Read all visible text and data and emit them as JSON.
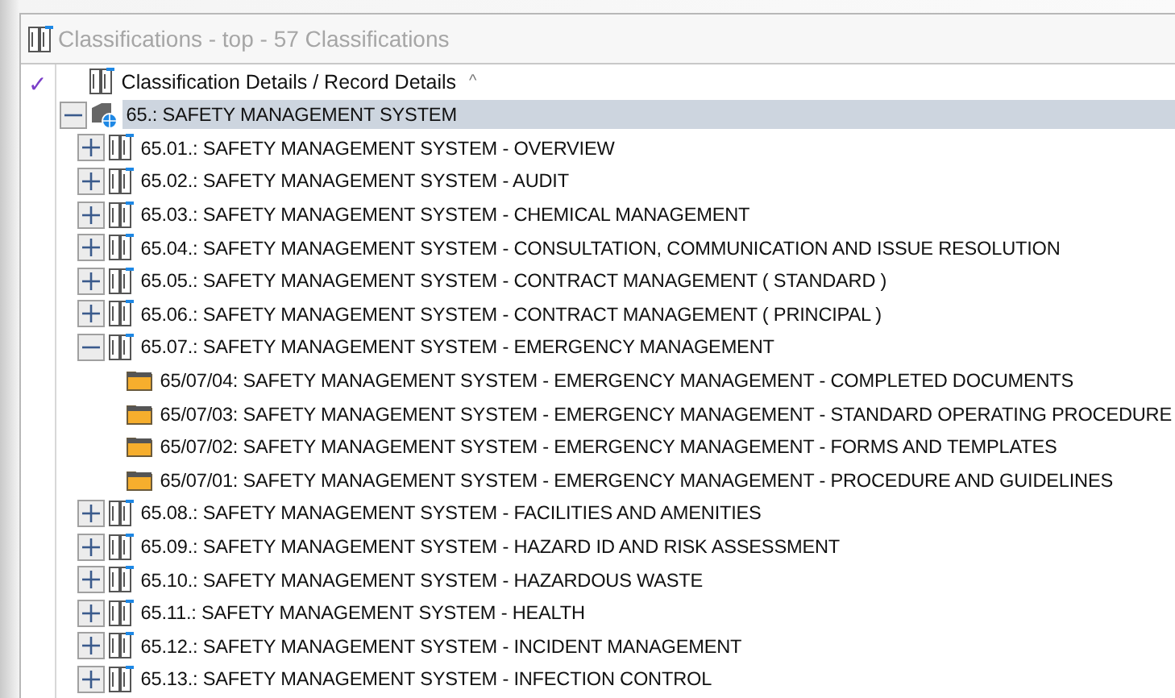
{
  "window": {
    "title": "Classifications - top - 57 Classifications"
  },
  "header": {
    "checked": true,
    "check_mark": "✓",
    "column": "Classification Details / Record Details",
    "sort": "^"
  },
  "tree": [
    {
      "label": "65.: SAFETY MANAGEMENT SYSTEM",
      "kind": "root",
      "expanded": true,
      "selected": true,
      "children": [
        {
          "label": "65.01.: SAFETY MANAGEMENT SYSTEM - OVERVIEW",
          "kind": "classification",
          "expanded": false,
          "selected": false
        },
        {
          "label": "65.02.: SAFETY MANAGEMENT SYSTEM - AUDIT",
          "kind": "classification",
          "expanded": false,
          "selected": false
        },
        {
          "label": "65.03.: SAFETY MANAGEMENT SYSTEM - CHEMICAL MANAGEMENT",
          "kind": "classification",
          "expanded": false,
          "selected": false
        },
        {
          "label": "65.04.: SAFETY MANAGEMENT SYSTEM - CONSULTATION, COMMUNICATION AND ISSUE RESOLUTION",
          "kind": "classification",
          "expanded": false,
          "selected": false
        },
        {
          "label": "65.05.: SAFETY MANAGEMENT SYSTEM - CONTRACT MANAGEMENT ( STANDARD )",
          "kind": "classification",
          "expanded": false,
          "selected": false
        },
        {
          "label": "65.06.: SAFETY MANAGEMENT SYSTEM - CONTRACT MANAGEMENT ( PRINCIPAL )",
          "kind": "classification",
          "expanded": false,
          "selected": false
        },
        {
          "label": "65.07.: SAFETY MANAGEMENT SYSTEM - EMERGENCY MANAGEMENT",
          "kind": "classification",
          "expanded": true,
          "selected": false,
          "children": [
            {
              "label": "65/07/04: SAFETY MANAGEMENT SYSTEM - EMERGENCY MANAGEMENT - COMPLETED DOCUMENTS",
              "kind": "folder",
              "selected": false
            },
            {
              "label": "65/07/03: SAFETY MANAGEMENT SYSTEM - EMERGENCY MANAGEMENT - STANDARD OPERATING PROCEDURE",
              "kind": "folder",
              "selected": false
            },
            {
              "label": "65/07/02: SAFETY MANAGEMENT SYSTEM - EMERGENCY MANAGEMENT - FORMS AND TEMPLATES",
              "kind": "folder",
              "selected": false
            },
            {
              "label": "65/07/01: SAFETY MANAGEMENT SYSTEM - EMERGENCY MANAGEMENT - PROCEDURE AND GUIDELINES",
              "kind": "folder",
              "selected": false
            }
          ]
        },
        {
          "label": "65.08.: SAFETY MANAGEMENT SYSTEM - FACILITIES AND AMENITIES",
          "kind": "classification",
          "expanded": false,
          "selected": false
        },
        {
          "label": "65.09.: SAFETY MANAGEMENT SYSTEM - HAZARD ID AND RISK ASSESSMENT",
          "kind": "classification",
          "expanded": false,
          "selected": false
        },
        {
          "label": "65.10.: SAFETY MANAGEMENT SYSTEM - HAZARDOUS WASTE",
          "kind": "classification",
          "expanded": false,
          "selected": false
        },
        {
          "label": "65.11.: SAFETY MANAGEMENT SYSTEM - HEALTH",
          "kind": "classification",
          "expanded": false,
          "selected": false
        },
        {
          "label": "65.12.: SAFETY MANAGEMENT SYSTEM - INCIDENT MANAGEMENT",
          "kind": "classification",
          "expanded": false,
          "selected": false
        },
        {
          "label": "65.13.: SAFETY MANAGEMENT SYSTEM - INFECTION CONTROL",
          "kind": "classification",
          "expanded": false,
          "selected": false
        }
      ]
    }
  ]
}
